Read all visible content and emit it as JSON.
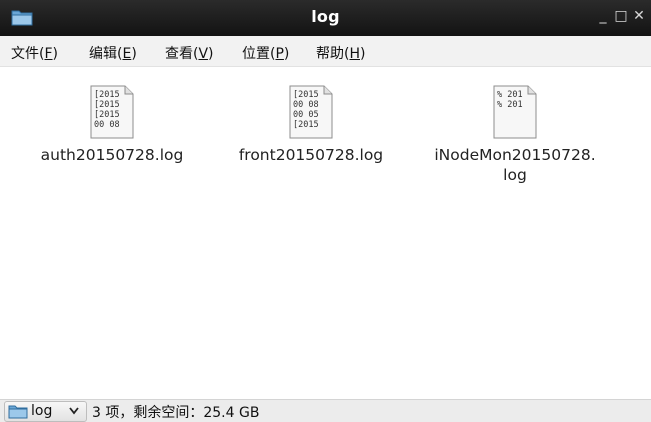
{
  "window": {
    "title": "log",
    "controls": {
      "minimize": "_",
      "maximize": "□",
      "close": "✕"
    }
  },
  "menu": [
    {
      "label": "文件(",
      "key": "F",
      "end": ")"
    },
    {
      "label": "编辑(",
      "key": "E",
      "end": ")"
    },
    {
      "label": "查看(",
      "key": "V",
      "end": ")"
    },
    {
      "label": "位置(",
      "key": "P",
      "end": ")"
    },
    {
      "label": "帮助(",
      "key": "H",
      "end": ")"
    }
  ],
  "files": [
    {
      "name": "auth20150728.log",
      "preview": [
        "[2015",
        "[2015",
        "[2015",
        "00 08"
      ]
    },
    {
      "name": "front20150728.log",
      "preview": [
        "[2015",
        "00 08",
        "00 05",
        "[2015"
      ]
    },
    {
      "name_line1": "iNodeMon20150728.",
      "name_line2": "log",
      "preview": [
        "% 201",
        "% 201"
      ]
    }
  ],
  "statusbar": {
    "location_label": "log",
    "summary": "3 项，剩余空间：25.4 GB"
  }
}
